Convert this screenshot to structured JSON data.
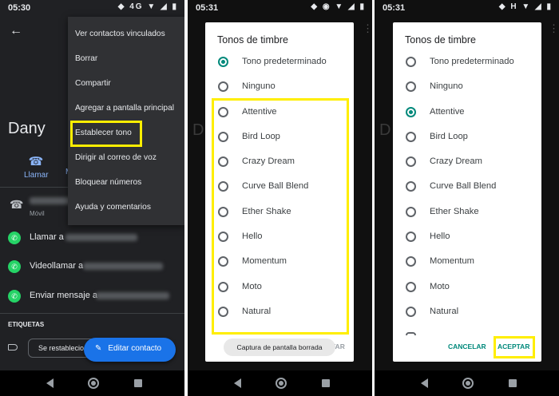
{
  "colors": {
    "highlight": "#ffee00",
    "accent_teal": "#00897b",
    "fab_blue": "#1a73e8",
    "dark_bg": "#202124",
    "whatsapp": "#25d366"
  },
  "panel1": {
    "status_time": "05:30",
    "status_icons": "◆ 4G ▼ ◢ ▮",
    "back_icon": "arrow-back-icon",
    "contact_name": "Dany",
    "call_label": "Llamar",
    "msg_fragment": "M",
    "menu": [
      "Ver contactos vinculados",
      "Borrar",
      "Compartir",
      "Agregar a pantalla principal",
      "Establecer tono",
      "Dirigir al correo de voz",
      "Bloquear números",
      "Ayuda y comentarios"
    ],
    "movil_label": "Móvil",
    "wa_rows": [
      "Llamar a",
      "Videollamar a",
      "Enviar mensaje a"
    ],
    "etiquetas": "ETIQUETAS",
    "chip_label": "Se restablecio",
    "fab_label": "Editar contacto"
  },
  "panel2": {
    "status_time": "05:31",
    "status_icons": "◆ ◉ ▼ ◢ ▮",
    "bg_letter": "D",
    "dialog_title": "Tonos de timbre",
    "options": [
      "Tono predeterminado",
      "Ninguno",
      "Attentive",
      "Bird Loop",
      "Crazy Dream",
      "Curve Ball Blend",
      "Ether Shake",
      "Hello",
      "Momentum",
      "Moto",
      "Natural"
    ],
    "selected_index": 0,
    "toast": "Captura de pantalla borrada",
    "ok_fragment": "TAR"
  },
  "panel3": {
    "status_time": "05:31",
    "status_icons": "◆ H ▼ ◢ ▮",
    "bg_letter": "D",
    "dialog_title": "Tonos de timbre",
    "options": [
      "Tono predeterminado",
      "Ninguno",
      "Attentive",
      "Bird Loop",
      "Crazy Dream",
      "Curve Ball Blend",
      "Ether Shake",
      "Hello",
      "Momentum",
      "Moto",
      "Natural"
    ],
    "selected_index": 2,
    "cancel_label": "CANCELAR",
    "ok_label": "ACEPTAR"
  }
}
